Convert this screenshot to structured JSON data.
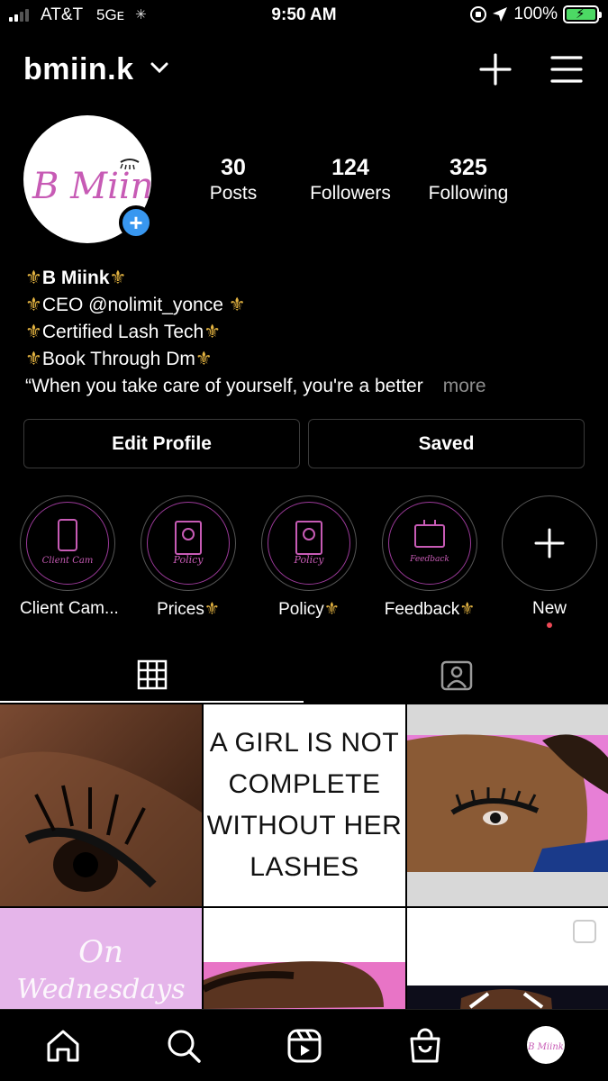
{
  "status_bar": {
    "carrier": "AT&T",
    "network": "5Gᴇ",
    "time": "9:50 AM",
    "battery": "100%",
    "signal_bars": 2
  },
  "header": {
    "username": "bmiin.k",
    "icons": [
      "chevron-down-icon",
      "plus-icon",
      "hamburger-menu-icon"
    ]
  },
  "profile": {
    "avatar_text": "B Miink",
    "stats": [
      {
        "value": "30",
        "label": "Posts"
      },
      {
        "value": "124",
        "label": "Followers"
      },
      {
        "value": "325",
        "label": "Following"
      }
    ],
    "bio": {
      "name": "B Miink",
      "lines": [
        "CEO  @nolimit_yonce",
        "Certified Lash Tech",
        "Book Through Dm"
      ],
      "quote": "“When you take care of yourself, you're a better",
      "more": "more"
    }
  },
  "buttons": {
    "edit_profile": "Edit Profile",
    "saved": "Saved"
  },
  "highlights": [
    {
      "label": "Client Cam...",
      "inner_text": "Client Cam"
    },
    {
      "label": "Prices",
      "inner_text": "Policy"
    },
    {
      "label": "Policy",
      "inner_text": "Policy"
    },
    {
      "label": "Feedback",
      "inner_text": "Feedback"
    },
    {
      "label": "New"
    }
  ],
  "tabs": [
    "grid-icon",
    "tagged-icon"
  ],
  "grid": {
    "quote_post": [
      "A GIRL IS NOT",
      "COMPLETE",
      "WITHOUT HER",
      "LASHES"
    ],
    "script_post": [
      "On",
      "Wednesdays"
    ]
  },
  "bottom_nav": [
    "home-icon",
    "search-icon",
    "reels-icon",
    "shop-icon",
    "profile-avatar"
  ],
  "colors": {
    "accent_blue": "#3897f0",
    "fleur_gold": "#e3b341",
    "brand_pink": "#c75bb5",
    "notification_red": "#ed4956"
  }
}
